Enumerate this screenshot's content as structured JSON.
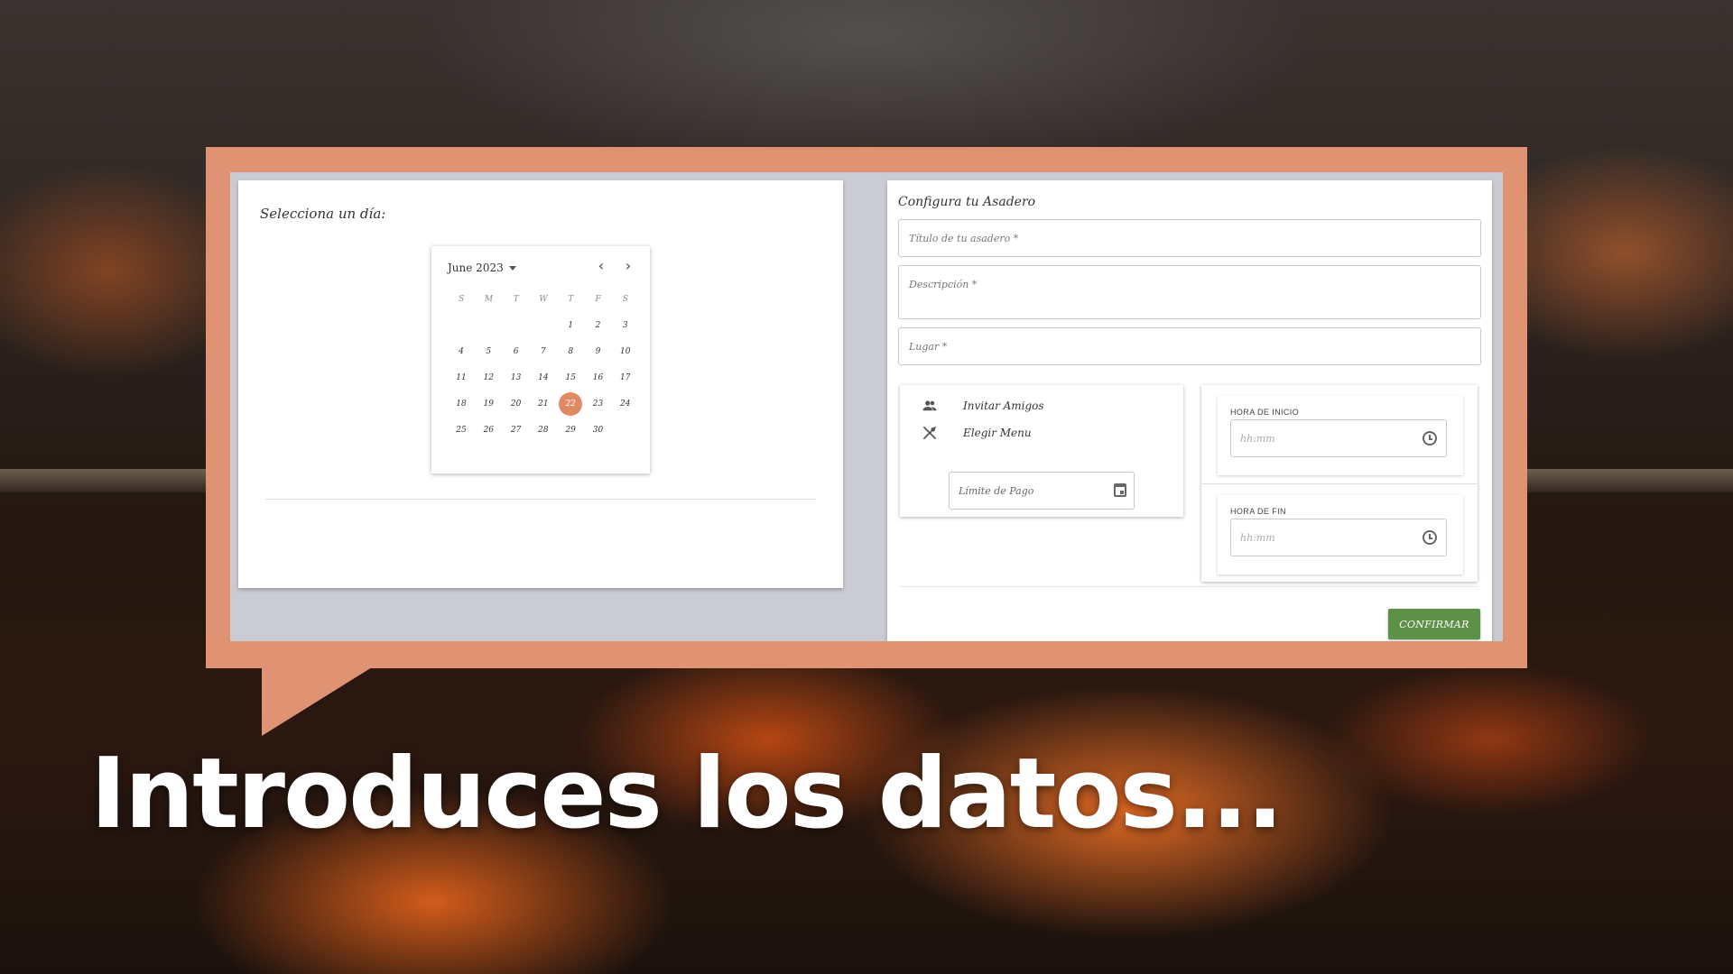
{
  "left_panel": {
    "title": "Selecciona un día:"
  },
  "calendar": {
    "month_label": "June 2023",
    "prev_icon": "chevron-left-icon",
    "next_icon": "chevron-right-icon",
    "weekdays": [
      "S",
      "M",
      "T",
      "W",
      "T",
      "F",
      "S"
    ],
    "first_weekday_index": 4,
    "days": [
      "1",
      "2",
      "3",
      "4",
      "5",
      "6",
      "7",
      "8",
      "9",
      "10",
      "11",
      "12",
      "13",
      "14",
      "15",
      "16",
      "17",
      "18",
      "19",
      "20",
      "21",
      "22",
      "23",
      "24",
      "25",
      "26",
      "27",
      "28",
      "29",
      "30"
    ],
    "selected_day": "22",
    "accent_color": "#e08a64"
  },
  "form": {
    "title": "Configura tu Asadero",
    "title_placeholder": "Título de tu asadero *",
    "description_placeholder": "Descripción *",
    "place_placeholder": "Lugar *",
    "invite_label": "Invitar Amigos",
    "invite_icon": "people-icon",
    "menu_label": "Elegir Menu",
    "menu_icon": "cutlery-icon",
    "payment_limit_placeholder": "Límite de Pago",
    "start_time_label": "HORA DE INICIO",
    "start_time_placeholder": "hh:mm",
    "end_time_label": "HORA DE FIN",
    "end_time_placeholder": "hh:mm",
    "confirm_label": "CONFIRMAR",
    "confirm_color": "#5e9148"
  },
  "headline": "Introduces los datos...",
  "frame_color": "#e09372"
}
